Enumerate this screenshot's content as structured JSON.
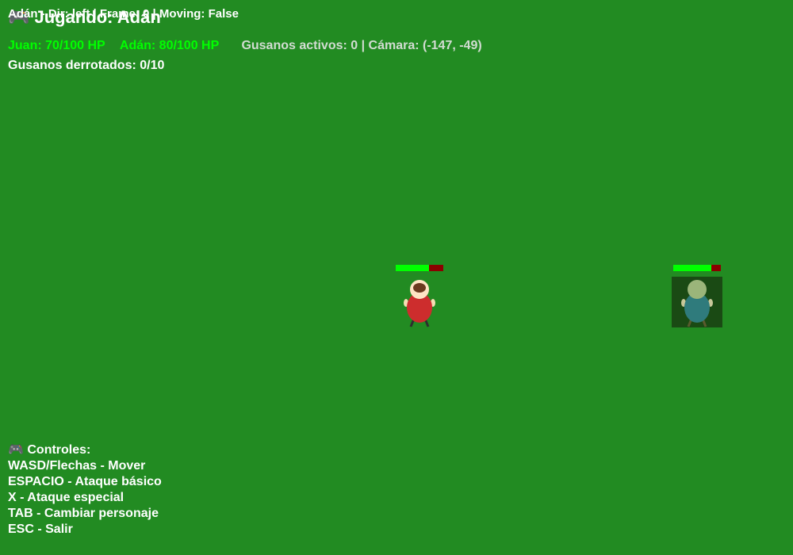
{
  "hud": {
    "title": "🎮 Jugando: Adán",
    "debug": "Adán - Dir: left | Frame: 0 | Moving: False",
    "juan_hp": "Juan: 70/100 HP",
    "adan_hp": "Adán: 80/100 HP",
    "info": "Gusanos activos: 0 | Cámara: (-147, -49)",
    "defeated": "Gusanos derrotados: 0/10"
  },
  "controls": {
    "header": "🎮 Controles:",
    "lines": [
      "WASD/Flechas - Mover",
      "ESPACIO - Ataque básico",
      "X - Ataque especial",
      "TAB - Cambiar personaje",
      "ESC - Salir"
    ]
  },
  "characters": {
    "juan": {
      "hp": 70,
      "max_hp": 100,
      "shirt_color": "#cd2d2d",
      "hair_color": "#6b3a1e"
    },
    "adan": {
      "hp": 80,
      "max_hp": 100,
      "shirt_color": "#2f7b7c",
      "active": true
    }
  },
  "colors": {
    "background": "#228b22",
    "hp_fill": "#00ff00",
    "hp_empty": "#8b0000"
  }
}
